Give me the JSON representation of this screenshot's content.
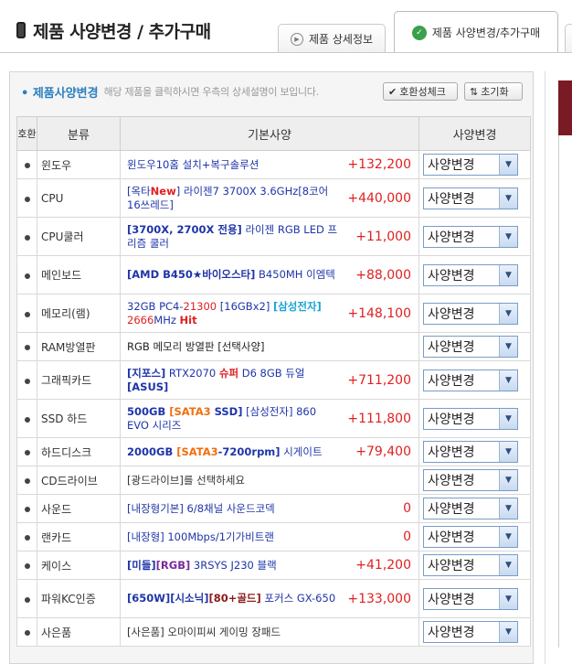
{
  "header": {
    "title": "제품 사양변경 / 추가구매",
    "tabs": [
      {
        "label": "제품 상세정보",
        "icon": "play-circle-icon"
      },
      {
        "label": "제품 사양변경/추가구매",
        "icon": "check-circle-icon"
      }
    ]
  },
  "panel": {
    "title": "• 제품사양변경",
    "description": "해당 제품을 클릭하시면 우측의 상세설명이 보입니다.",
    "buttons": {
      "compat": "호환성체크",
      "reset": "초기화"
    }
  },
  "table": {
    "headers": {
      "hohwan": "호환",
      "category": "분류",
      "spec": "기본사양",
      "change": "사양변경"
    },
    "select_label": "사양변경",
    "rows": [
      {
        "category": "윈도우",
        "price": "+132,200"
      },
      {
        "category": "CPU",
        "price": "+440,000"
      },
      {
        "category": "CPU쿨러",
        "price": "+11,000"
      },
      {
        "category": "메인보드",
        "price": "+88,000"
      },
      {
        "category": "메모리(램)",
        "price": "+148,100"
      },
      {
        "category": "RAM방열판",
        "price": ""
      },
      {
        "category": "그래픽카드",
        "price": "+711,200"
      },
      {
        "category": "SSD 하드",
        "price": "+111,800"
      },
      {
        "category": "하드디스크",
        "price": "+79,400"
      },
      {
        "category": "CD드라이브",
        "price": ""
      },
      {
        "category": "사운드",
        "price": "0"
      },
      {
        "category": "랜카드",
        "price": "0"
      },
      {
        "category": "케이스",
        "price": "+41,200"
      },
      {
        "category": "파워KC인증",
        "price": "+133,000"
      },
      {
        "category": "사은품",
        "price": ""
      }
    ],
    "specs": {
      "r0": {
        "a": "윈도우10홈 설치+복구솔루션"
      },
      "r1": {
        "a": "[옥타",
        "b": "New",
        "c": "] 라이젠7 3700X 3.6GHz[8코어16쓰레드]"
      },
      "r2": {
        "a": "[3700X, 2700X 전용]",
        "b": " 라이젠 RGB LED 프리즘 쿨러"
      },
      "r3": {
        "a": "[AMD B450",
        "b": "★",
        "c": "바이오스타]",
        "d": " B450MH 이엠텍"
      },
      "r4": {
        "a": "32GB PC4-",
        "b": "21300",
        "c": " [16GBx2] ",
        "d": "[삼성전자]",
        "e": " 2666",
        "f": "MHz ",
        "g": "Hit"
      },
      "r5": {
        "a": "RGB 메모리 방열판 [선택사양]"
      },
      "r6": {
        "a": "[지포스]",
        "b": " RTX2070 ",
        "c": "슈퍼",
        "d": " D6 8GB 듀얼 ",
        "e": "[ASUS]"
      },
      "r7": {
        "a": "500GB ",
        "b": "[SATA3 ",
        "c": "SSD]",
        "d": " [삼성전자] 860 EVO 시리즈"
      },
      "r8": {
        "a": "2000GB ",
        "b": "[SATA3",
        "c": "-7200rpm]",
        "d": " 시게이트"
      },
      "r9": {
        "a": "[광드라이브]를 선택하세요"
      },
      "r10": {
        "a": "[내장형기본] 6/8채널 사운드코덱"
      },
      "r11": {
        "a": "[내장형] 100Mbps/1기가비트랜"
      },
      "r12": {
        "a": "[미들]",
        "b": "[RGB]",
        "c": " 3RSYS J230 블랙"
      },
      "r13": {
        "a": "[650W][시소닉]",
        "b": "[80+골드]",
        "c": " 포커스 GX-650"
      },
      "r14": {
        "a": "[사은품] 오마이피씨 게이밍 장패드"
      }
    }
  }
}
